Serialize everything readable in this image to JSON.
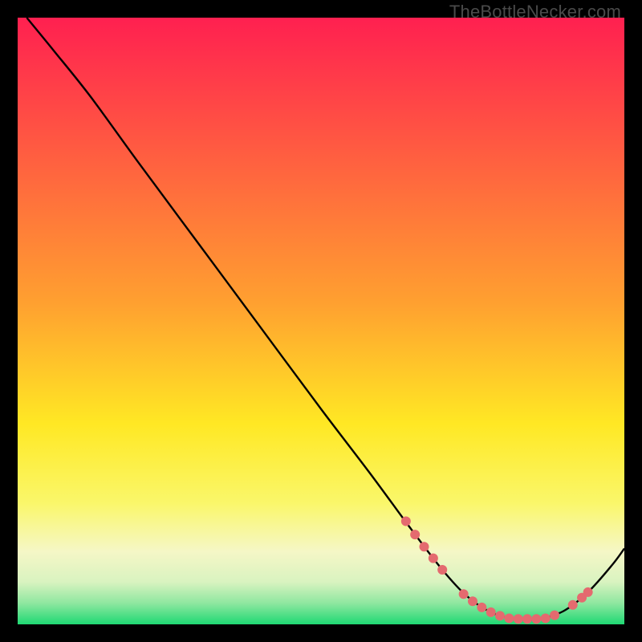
{
  "watermark": "TheBottleNecker.com",
  "chart_data": {
    "type": "line",
    "title": "",
    "xlabel": "",
    "ylabel": "",
    "xlim": [
      0,
      100
    ],
    "ylim": [
      0,
      100
    ],
    "gradient_stops": [
      {
        "offset": 0,
        "color": "#ff2050"
      },
      {
        "offset": 0.47,
        "color": "#ffa030"
      },
      {
        "offset": 0.67,
        "color": "#ffe824"
      },
      {
        "offset": 0.8,
        "color": "#faf76a"
      },
      {
        "offset": 0.88,
        "color": "#f5f7c6"
      },
      {
        "offset": 0.93,
        "color": "#d9f3c0"
      },
      {
        "offset": 0.965,
        "color": "#8fe7a0"
      },
      {
        "offset": 1.0,
        "color": "#1fd873"
      }
    ],
    "series": [
      {
        "name": "curve",
        "color": "#000000",
        "points": [
          {
            "x": 1.5,
            "y": 100
          },
          {
            "x": 6,
            "y": 94.5
          },
          {
            "x": 12,
            "y": 87
          },
          {
            "x": 20,
            "y": 76
          },
          {
            "x": 30,
            "y": 62.5
          },
          {
            "x": 40,
            "y": 49
          },
          {
            "x": 50,
            "y": 35.5
          },
          {
            "x": 58,
            "y": 25
          },
          {
            "x": 65,
            "y": 15.5
          },
          {
            "x": 70,
            "y": 9
          },
          {
            "x": 74,
            "y": 4.7
          },
          {
            "x": 78,
            "y": 2.0
          },
          {
            "x": 82,
            "y": 0.9
          },
          {
            "x": 86,
            "y": 0.9
          },
          {
            "x": 90,
            "y": 2.2
          },
          {
            "x": 94,
            "y": 5.3
          },
          {
            "x": 98,
            "y": 9.8
          },
          {
            "x": 100,
            "y": 12.5
          }
        ]
      }
    ],
    "markers": [
      {
        "x": 64.0,
        "y": 17.0
      },
      {
        "x": 65.5,
        "y": 14.8
      },
      {
        "x": 67.0,
        "y": 12.8
      },
      {
        "x": 68.5,
        "y": 10.9
      },
      {
        "x": 70.0,
        "y": 9.0
      },
      {
        "x": 73.5,
        "y": 5.0
      },
      {
        "x": 75.0,
        "y": 3.8
      },
      {
        "x": 76.5,
        "y": 2.8
      },
      {
        "x": 78.0,
        "y": 2.0
      },
      {
        "x": 79.5,
        "y": 1.4
      },
      {
        "x": 81.0,
        "y": 1.0
      },
      {
        "x": 82.5,
        "y": 0.9
      },
      {
        "x": 84.0,
        "y": 0.9
      },
      {
        "x": 85.5,
        "y": 0.9
      },
      {
        "x": 87.0,
        "y": 1.0
      },
      {
        "x": 88.5,
        "y": 1.5
      },
      {
        "x": 91.5,
        "y": 3.2
      },
      {
        "x": 93.0,
        "y": 4.4
      },
      {
        "x": 94.0,
        "y": 5.3
      }
    ],
    "marker_style": {
      "fill": "#e46a6f",
      "radius": 6
    }
  }
}
